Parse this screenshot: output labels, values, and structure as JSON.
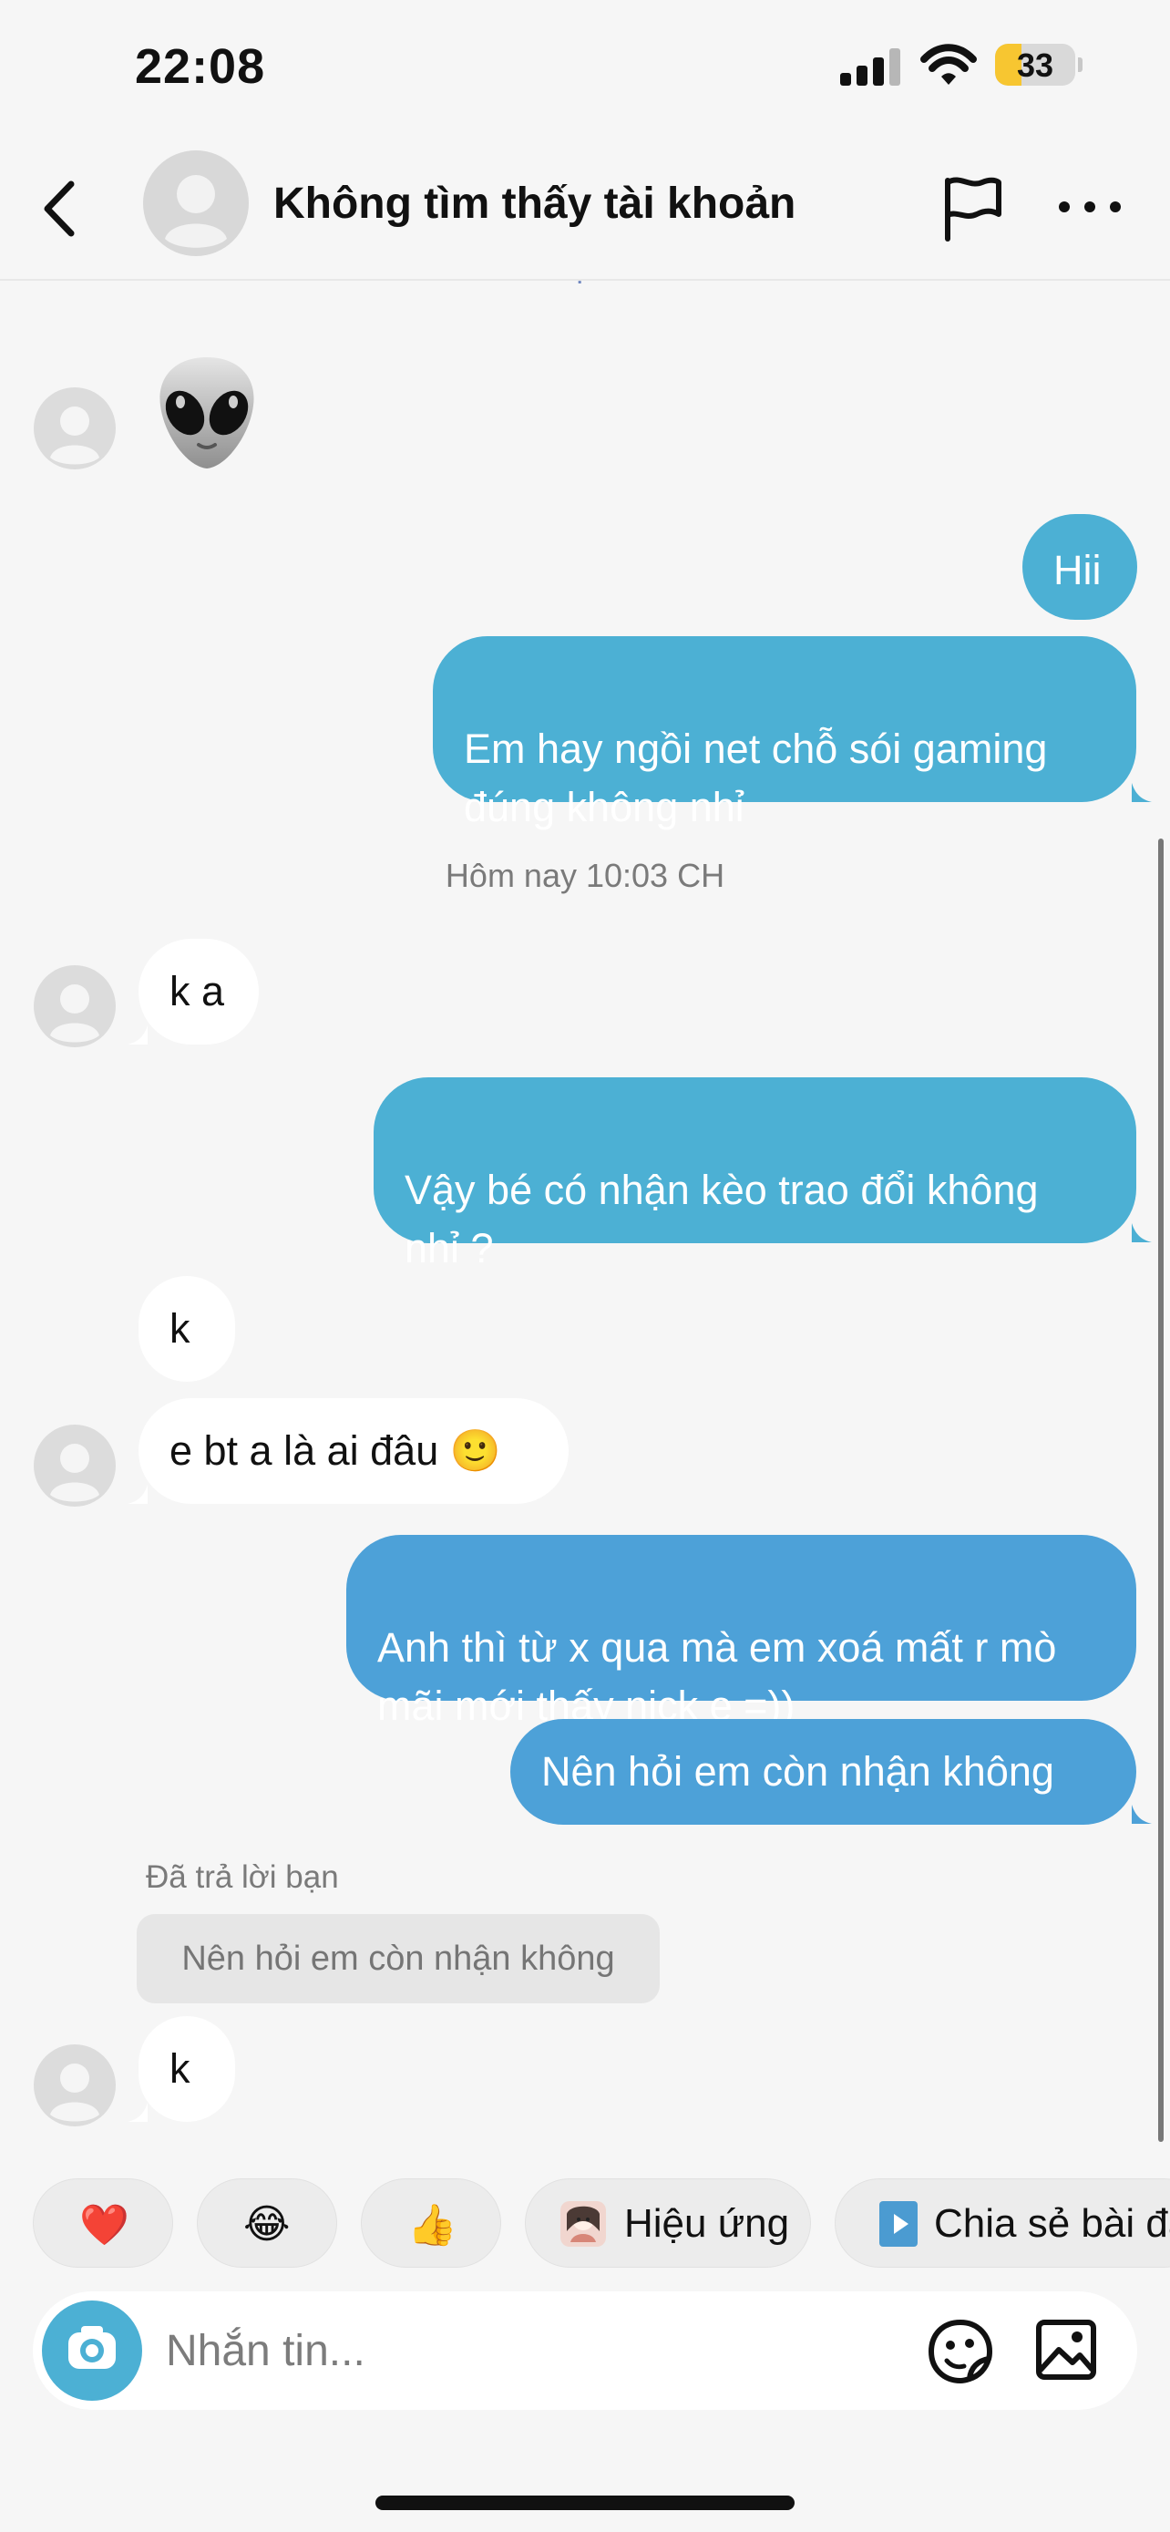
{
  "status_bar": {
    "time": "22:08",
    "battery_level": "33",
    "battery_percent": 0.33,
    "signal_icon": "cellular-signal-icon",
    "wifi_icon": "wifi-icon"
  },
  "header": {
    "title": "Không tìm thấy tài khoản",
    "back_icon": "chevron-left-icon",
    "avatar_icon": "default-avatar-icon",
    "report_icon": "flag-icon",
    "more_icon": "more-horizontal-icon"
  },
  "conversation": {
    "clipped_top_text": "bạn",
    "timestamp": "Hôm nay 10:03 CH",
    "reply_note": "Đã trả lời bạn",
    "reply_quote": "Nên hỏi em còn nhận không",
    "messages": [
      {
        "sender": "them",
        "type": "emoji",
        "text": "👽"
      },
      {
        "sender": "me",
        "text": "Hii"
      },
      {
        "sender": "me",
        "text": "Em hay ngồi net chỗ sói gaming\nđúng không nhỉ"
      },
      {
        "sender": "them",
        "text": "k a"
      },
      {
        "sender": "me",
        "text": "Vậy bé có nhận kèo trao đổi không\nnhỉ ?"
      },
      {
        "sender": "them",
        "text": "k"
      },
      {
        "sender": "them",
        "text": "e bt a là ai đâu 🙂"
      },
      {
        "sender": "me",
        "text": "Anh thì từ x qua mà em xoá mất r mò\nmãi mới thấy nick e =))"
      },
      {
        "sender": "me",
        "text": "Nên hỏi em còn nhận không"
      },
      {
        "sender": "them",
        "text": "k"
      }
    ]
  },
  "quick_reactions": [
    {
      "label": "❤️",
      "icon": "heart-emoji"
    },
    {
      "label": "😂",
      "icon": "laughing-emoji"
    },
    {
      "label": "👍",
      "icon": "thumbs-up-emoji"
    },
    {
      "label": "Hiệu ứng",
      "icon": "avatar-effect-icon"
    },
    {
      "label": "Chia sẻ bài đă",
      "icon": "play-icon"
    }
  ],
  "composer": {
    "placeholder": "Nhắn tin...",
    "camera_icon": "camera-icon",
    "sticker_icon": "sticker-icon",
    "image_icon": "image-icon"
  },
  "colors": {
    "outgoing_bubble": "#4cb0d4",
    "outgoing_bubble_dark": "#4da1d8",
    "incoming_bubble": "#ffffff",
    "background": "#f6f6f6"
  }
}
